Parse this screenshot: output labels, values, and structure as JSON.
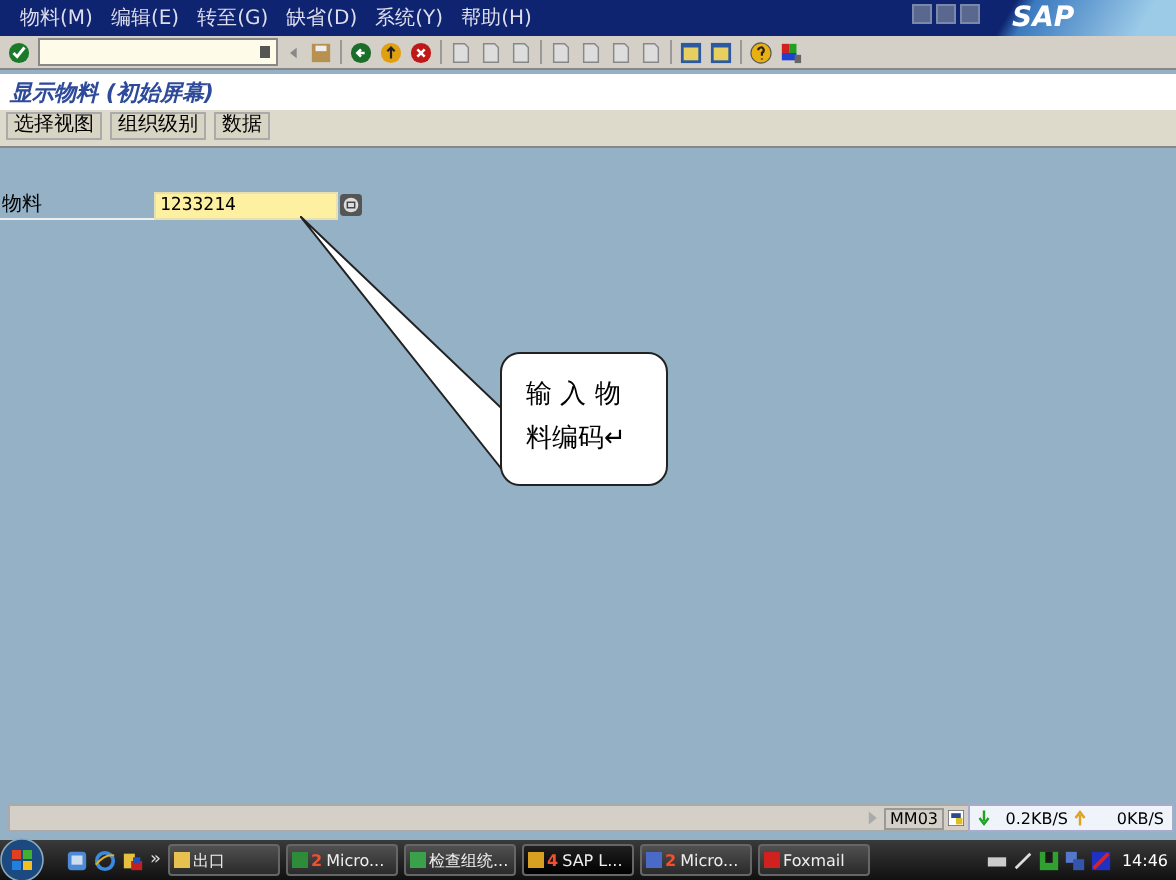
{
  "menu": [
    "物料(M)",
    "编辑(E)",
    "转至(G)",
    "缺省(D)",
    "系统(Y)",
    "帮助(H)"
  ],
  "logo": "SAP",
  "screen_title": "显示物料 (初始屏幕)",
  "app_buttons": [
    "选择视图",
    "组织级别",
    "数据"
  ],
  "fields": [
    {
      "label": "物料",
      "value": "1233214"
    }
  ],
  "callout": "输 入 物料编码↵",
  "status_bar": {
    "transaction": "MM03"
  },
  "net_monitor": {
    "down": "0.2KB/S",
    "up": "0KB/S"
  },
  "taskbar": {
    "more": "»",
    "tasks": [
      {
        "label": "出口",
        "selected": false
      },
      {
        "count": "2",
        "label": "Micro...",
        "selected": false
      },
      {
        "label": "检查组统...",
        "selected": false
      },
      {
        "count": "4",
        "label": "SAP L...",
        "selected": true
      },
      {
        "count": "2",
        "label": "Micro...",
        "selected": false
      },
      {
        "label": "Foxmail",
        "selected": false
      }
    ],
    "clock": "14:46"
  }
}
